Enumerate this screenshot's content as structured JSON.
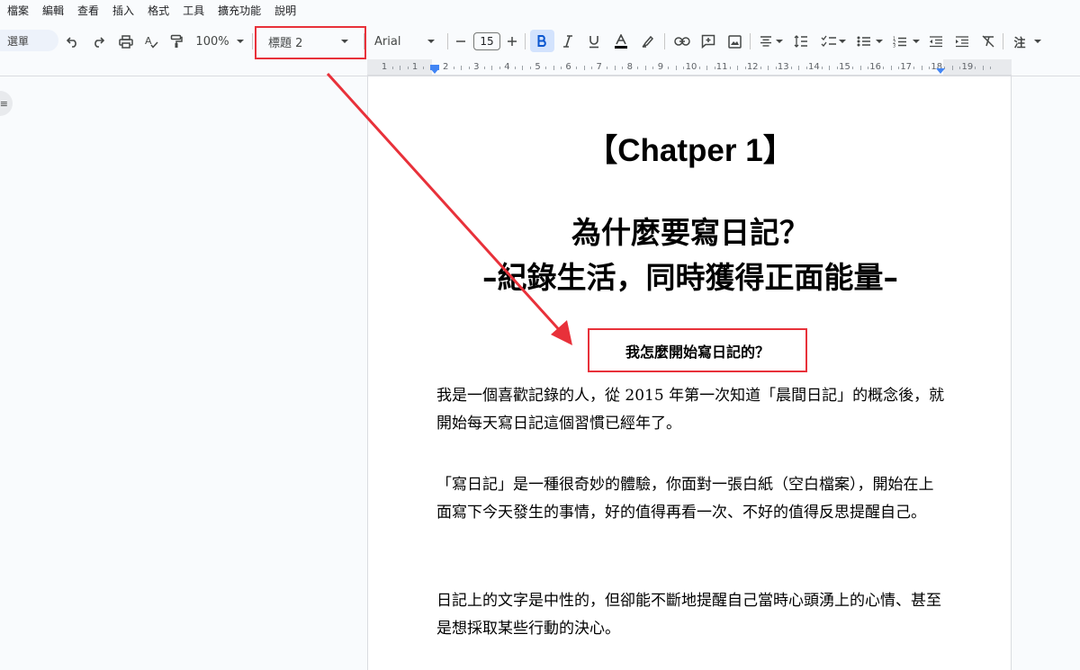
{
  "menu": [
    "檔案",
    "編輯",
    "查看",
    "插入",
    "格式",
    "工具",
    "擴充功能",
    "說明"
  ],
  "toolbar": {
    "search_label": "選單",
    "zoom": "100%",
    "paragraph_style": "標題 2",
    "font": "Arial",
    "font_size": "15",
    "mode_label": "注"
  },
  "ruler": {
    "labels": [
      "1",
      "1",
      "2",
      "3",
      "4",
      "5",
      "6",
      "7",
      "8",
      "9",
      "10",
      "11",
      "12",
      "13",
      "14",
      "15",
      "16",
      "17",
      "18",
      "19"
    ]
  },
  "document": {
    "chapter": "【Chatper 1】",
    "title_line1": "為什麼要寫日記？",
    "title_line2": "–紀錄生活，同時獲得正面能量–",
    "heading2": "我怎麼開始寫日記的？",
    "para1": "我是一個喜歡記錄的人，從 2015 年第一次知道「晨間日記」的概念後，就開始每天寫日記這個習慣已經年了。",
    "para2": "「寫日記」是一種很奇妙的體驗，你面對一張白紙（空白檔案），開始在上面寫下今天發生的事情，好的值得再看一次、不好的值得反思提醒自己。",
    "para3": "日記上的文字是中性的，但卻能不斷地提醒自己當時心頭湧上的心情、甚至是想採取某些行動的決心。"
  },
  "colors": {
    "annotation_red": "#e8313a",
    "active_button_bg": "#d3e3fd"
  }
}
